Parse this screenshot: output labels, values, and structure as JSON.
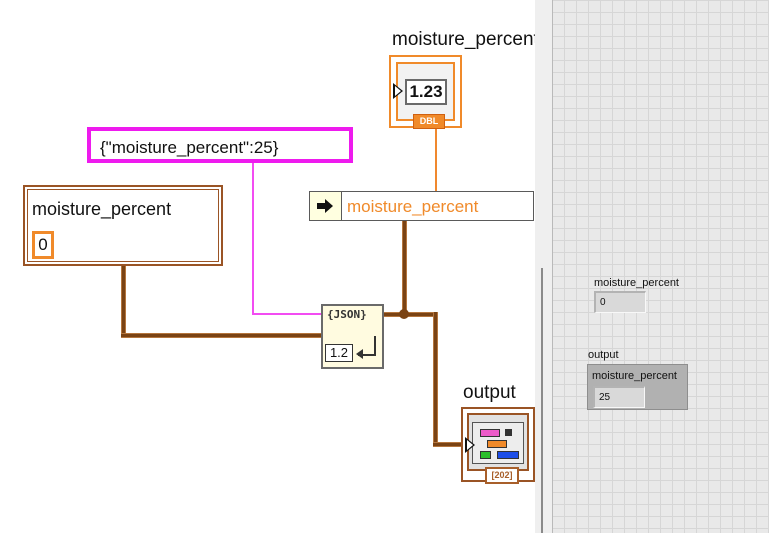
{
  "block_diagram": {
    "json_constant": "{\"moisture_percent\":25}",
    "cluster_control": {
      "label": "moisture_percent",
      "value": "0"
    },
    "unbundle": {
      "field": "moisture_percent"
    },
    "dbl_indicator": {
      "label": "moisture_percent",
      "display": "1.23",
      "type_tag": "DBL"
    },
    "json_function": {
      "top": "{JSON}",
      "num": "1.2"
    },
    "output_indicator": {
      "label": "output",
      "type_tag": "[202]"
    }
  },
  "front_panel": {
    "control": {
      "label": "moisture_percent",
      "value": "0"
    },
    "output": {
      "label": "output",
      "field_label": "moisture_percent",
      "value": "25"
    }
  },
  "colors": {
    "wire_cluster": "#7a4314",
    "wire_string": "#f24cf2",
    "wire_numeric": "#f08a2a"
  }
}
